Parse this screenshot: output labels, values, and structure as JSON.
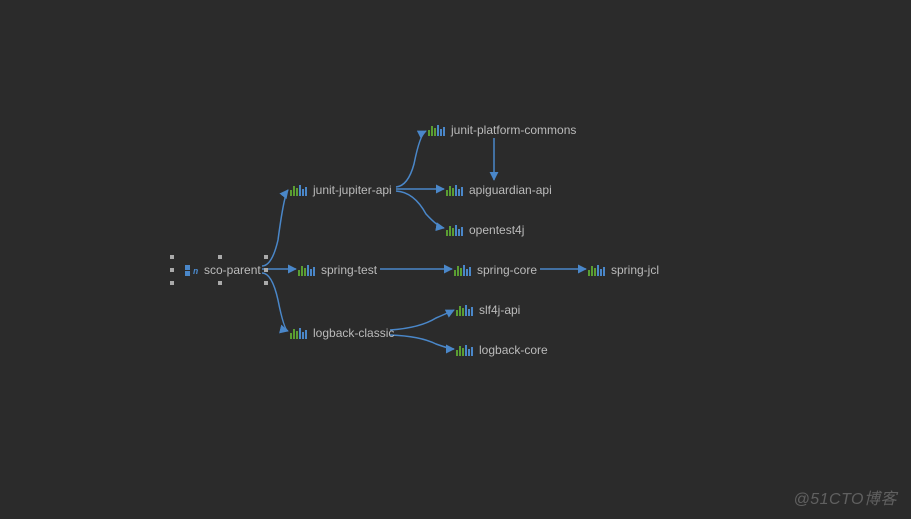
{
  "nodes": {
    "root": {
      "label": "sco-parent"
    },
    "junit_jupiter": {
      "label": "junit-jupiter-api"
    },
    "spring_test": {
      "label": "spring-test"
    },
    "logback_classic": {
      "label": "logback-classic"
    },
    "junit_platform": {
      "label": "junit-platform-commons"
    },
    "apiguardian": {
      "label": "apiguardian-api"
    },
    "opentest4j": {
      "label": "opentest4j"
    },
    "spring_core": {
      "label": "spring-core"
    },
    "spring_jcl": {
      "label": "spring-jcl"
    },
    "slf4j": {
      "label": "slf4j-api"
    },
    "logback_core": {
      "label": "logback-core"
    }
  },
  "watermark": "@51CTO博客"
}
